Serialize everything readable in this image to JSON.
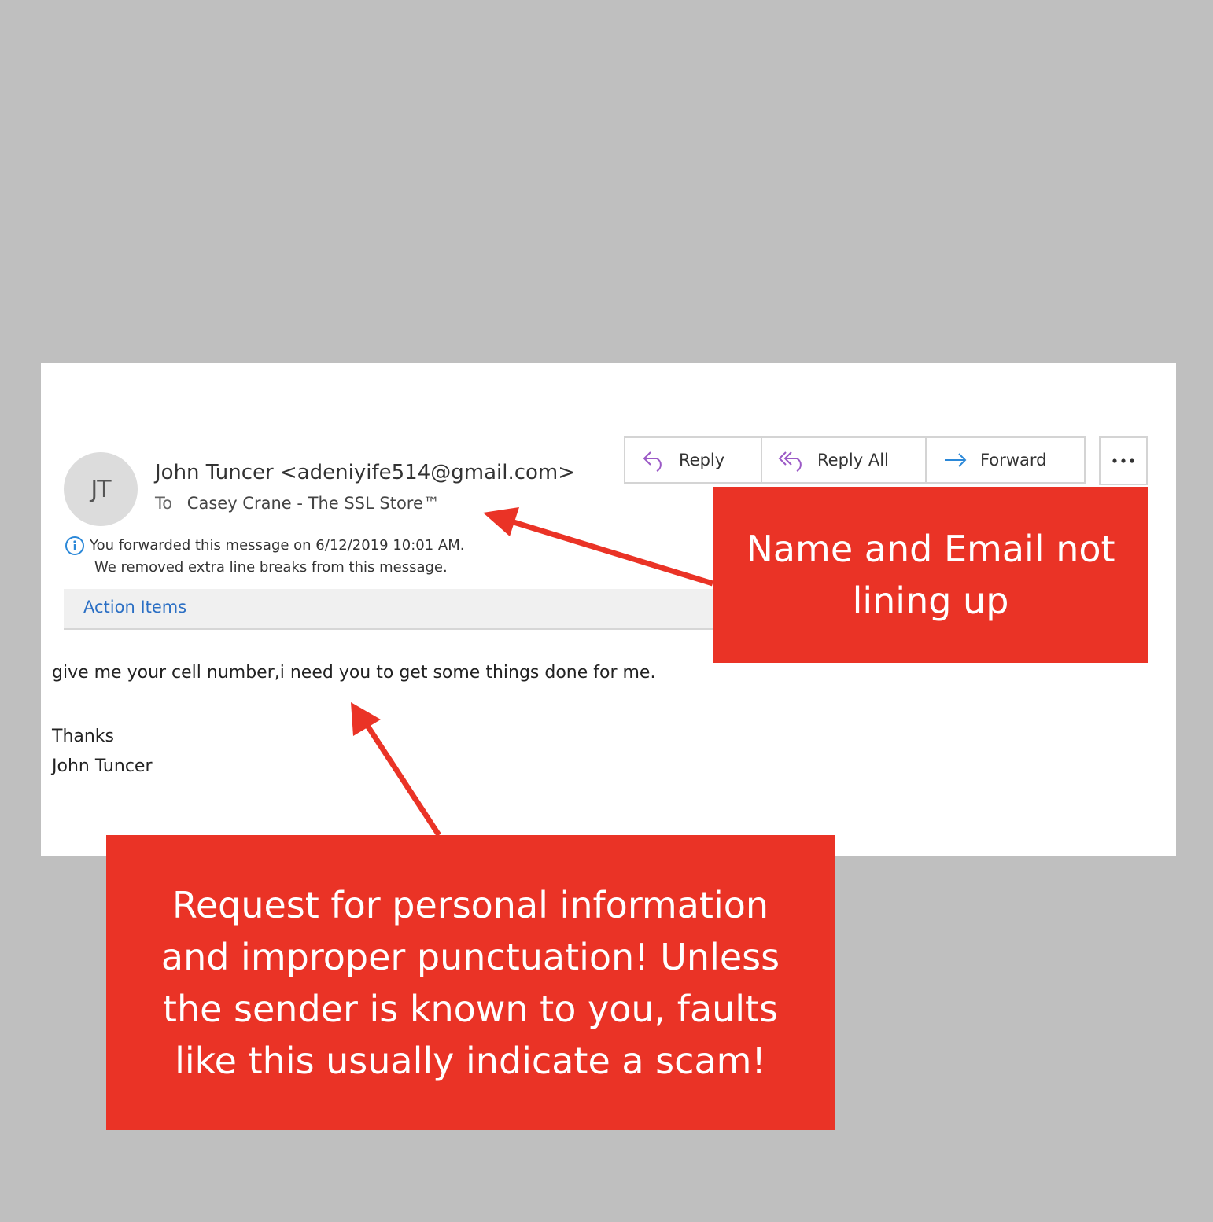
{
  "email": {
    "avatar_initials": "JT",
    "sender": "John Tuncer <adeniyife514@gmail.com>",
    "to_label": "To",
    "recipient": "Casey Crane - The SSL Store™",
    "info_line1": "You forwarded this message on 6/12/2019 10:01 AM.",
    "info_line2": "We removed extra line breaks from this message.",
    "action_items": "Action Items",
    "body": "give me your cell number,i need you to get some things done for me.",
    "signoff": "Thanks",
    "signature": "John Tuncer"
  },
  "toolbar": {
    "reply": "Reply",
    "reply_all": "Reply All",
    "forward": "Forward",
    "more": "..."
  },
  "callouts": {
    "name_email": "Name and Email not lining up",
    "personal_info": "Request for personal information and improper punctuation! Unless the sender is known to you, faults like this usually indicate a scam!"
  },
  "colors": {
    "callout": "#ea3326",
    "background": "#bfbfbf",
    "link": "#2b6fc4",
    "reply_icon": "#9b59c6",
    "forward_icon": "#2b88d8"
  }
}
